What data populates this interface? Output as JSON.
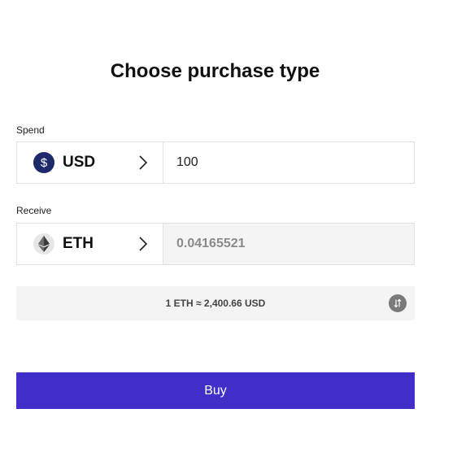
{
  "title": "Choose purchase type",
  "spend": {
    "label": "Spend",
    "currency": "USD",
    "currency_icon": "dollar-icon",
    "amount": "100"
  },
  "receive": {
    "label": "Receive",
    "currency": "ETH",
    "currency_icon": "ethereum-icon",
    "amount": "0.04165521"
  },
  "rate": {
    "text": "1 ETH ≈ 2,400.66 USD",
    "swap_icon": "swap-arrows-icon"
  },
  "buy_label": "Buy",
  "colors": {
    "primary": "#412ec9",
    "usd_coin": "#1c2a6b",
    "panel_gray": "#f4f4f4"
  }
}
